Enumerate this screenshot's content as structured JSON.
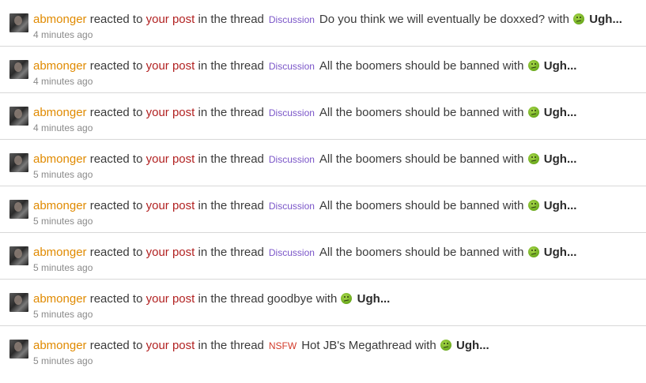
{
  "notifications": [
    {
      "user": "abmonger",
      "reacted_text": "reacted to",
      "post_text": "your post",
      "in_thread_text": "in the thread",
      "prefix": "Discussion",
      "prefix_type": "discussion",
      "thread_title": "Do you think we will eventually be doxxed?",
      "with_text": "with",
      "reaction": "Ugh...",
      "time": "4 minutes ago"
    },
    {
      "user": "abmonger",
      "reacted_text": "reacted to",
      "post_text": "your post",
      "in_thread_text": "in the thread",
      "prefix": "Discussion",
      "prefix_type": "discussion",
      "thread_title": "All the boomers should be banned",
      "with_text": "with",
      "reaction": "Ugh...",
      "time": "4 minutes ago"
    },
    {
      "user": "abmonger",
      "reacted_text": "reacted to",
      "post_text": "your post",
      "in_thread_text": "in the thread",
      "prefix": "Discussion",
      "prefix_type": "discussion",
      "thread_title": "All the boomers should be banned",
      "with_text": "with",
      "reaction": "Ugh...",
      "time": "4 minutes ago"
    },
    {
      "user": "abmonger",
      "reacted_text": "reacted to",
      "post_text": "your post",
      "in_thread_text": "in the thread",
      "prefix": "Discussion",
      "prefix_type": "discussion",
      "thread_title": "All the boomers should be banned",
      "with_text": "with",
      "reaction": "Ugh...",
      "time": "5 minutes ago"
    },
    {
      "user": "abmonger",
      "reacted_text": "reacted to",
      "post_text": "your post",
      "in_thread_text": "in the thread",
      "prefix": "Discussion",
      "prefix_type": "discussion",
      "thread_title": "All the boomers should be banned",
      "with_text": "with",
      "reaction": "Ugh...",
      "time": "5 minutes ago"
    },
    {
      "user": "abmonger",
      "reacted_text": "reacted to",
      "post_text": "your post",
      "in_thread_text": "in the thread",
      "prefix": "Discussion",
      "prefix_type": "discussion",
      "thread_title": "All the boomers should be banned",
      "with_text": "with",
      "reaction": "Ugh...",
      "time": "5 minutes ago"
    },
    {
      "user": "abmonger",
      "reacted_text": "reacted to",
      "post_text": "your post",
      "in_thread_text": "in the thread",
      "prefix": "",
      "prefix_type": "none",
      "thread_title": "goodbye",
      "with_text": "with",
      "reaction": "Ugh...",
      "time": "5 minutes ago"
    },
    {
      "user": "abmonger",
      "reacted_text": "reacted to",
      "post_text": "your post",
      "in_thread_text": "in the thread",
      "prefix": "NSFW",
      "prefix_type": "nsfw",
      "thread_title": "Hot JB's Megathread",
      "with_text": "with",
      "reaction": "Ugh...",
      "time": "5 minutes ago"
    }
  ],
  "icons": {
    "avatar": "user-avatar",
    "reaction": "ugh-emoji-icon"
  },
  "colors": {
    "user": "#e08a00",
    "post": "#b22222",
    "discussion": "#7a55c8",
    "nsfw": "#d23a2a",
    "time": "#8a8a8a"
  }
}
